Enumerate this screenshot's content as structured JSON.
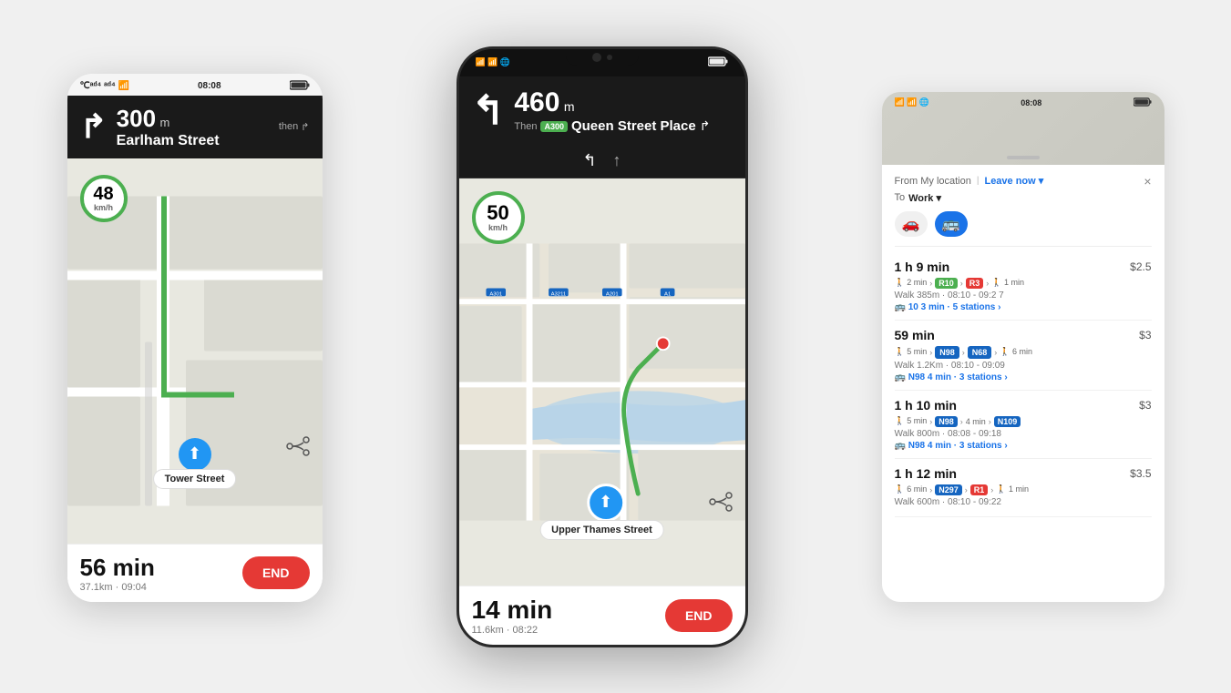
{
  "left_phone": {
    "status": {
      "signal": "📶",
      "time": "08:08",
      "battery": "100"
    },
    "nav_header": {
      "distance": "300",
      "unit": "m",
      "street": "Earlham Street",
      "then": "then"
    },
    "speed": "48",
    "speed_unit": "km/h",
    "street_label": "Tower Street",
    "footer": {
      "time": "56 min",
      "sub": "37.1km · 09:04",
      "end_btn": "END"
    }
  },
  "center_phone": {
    "status": {
      "time": "08:08"
    },
    "nav_header": {
      "distance": "460",
      "unit": "m",
      "then": "Then",
      "road_badge": "A300",
      "street": "Queen Street Place"
    },
    "speed": "50",
    "speed_unit": "km/h",
    "street_label": "Upper Thames Street",
    "footer": {
      "time": "14 min",
      "sub": "11.6km · 08:22",
      "end_btn": "END"
    }
  },
  "right_panel": {
    "status": {
      "time": "08:08"
    },
    "from_label": "From My location",
    "leave_now": "Leave now ▾",
    "to_label": "To",
    "to_dest": "Work ▾",
    "close": "×",
    "mode_car": "🚗",
    "mode_bus": "🚌",
    "routes": [
      {
        "time": "1 h 9 min",
        "price": "$2.5",
        "badges": [
          "2 min",
          "R10",
          "R3",
          "1 min"
        ],
        "detail": "Walk 385m  ·  08:10 - 09:2 7",
        "highlight": "🚌 10  3 min · 5 stations ›",
        "badge_colors": [
          "#4caf50",
          "#e53935"
        ]
      },
      {
        "time": "59 min",
        "price": "$3",
        "badges": [
          "5 min",
          "N98",
          "N68",
          "6 min"
        ],
        "detail": "Walk 1.2Km  ·  08:10 - 09:09",
        "highlight": "🚌 N98  4 min · 3 stations ›",
        "badge_colors": [
          "#1565c0",
          "#1565c0"
        ]
      },
      {
        "time": "1 h 10 min",
        "price": "$3",
        "badges": [
          "5 min",
          "N98",
          "4 min",
          "N109"
        ],
        "detail": "Walk 800m  ·  08:08 - 09:18",
        "highlight": "🚌 N98  4 min · 3 stations ›",
        "badge_colors": [
          "#1565c0",
          "#1565c0"
        ]
      },
      {
        "time": "1 h 12 min",
        "price": "$3.5",
        "badges": [
          "6 min",
          "N297",
          "R1",
          "1 min"
        ],
        "detail": "Walk 600m  ·  08:10 - 09:22",
        "highlight": "",
        "badge_colors": [
          "#1565c0",
          "#e53935"
        ]
      }
    ]
  }
}
